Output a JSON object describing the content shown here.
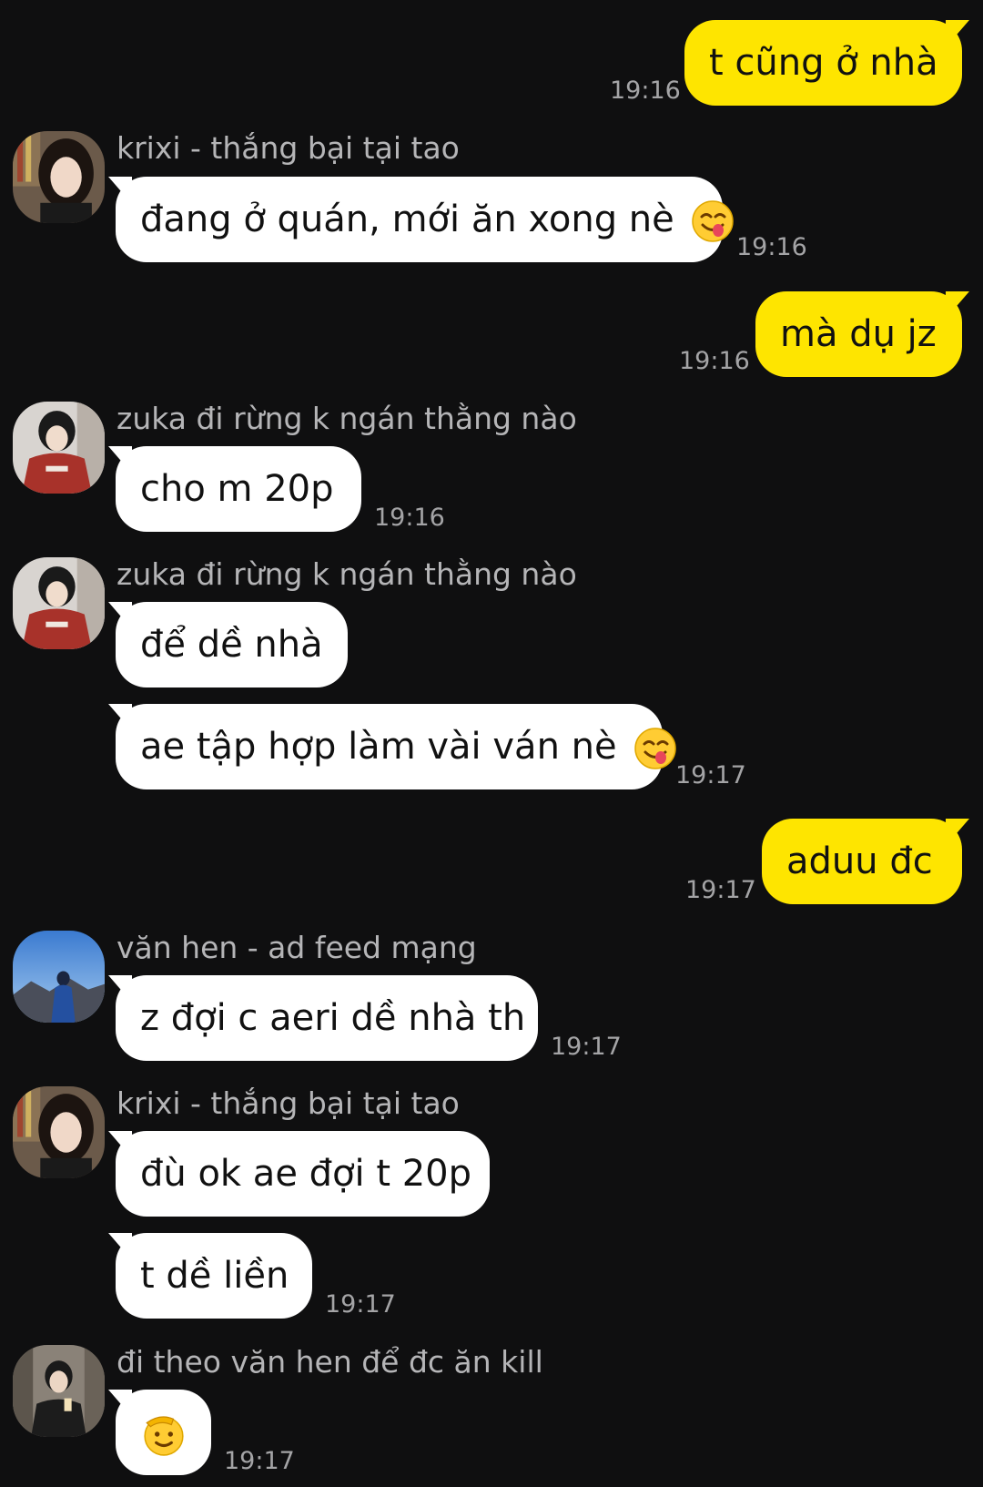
{
  "messages": [
    {
      "text": "t cũng ở nhà",
      "time": "19:16"
    },
    {
      "sender": "krixi - thắng bại tại tao",
      "text": "đang ở quán, mới ăn xong nè",
      "emoji": "yum-face-emoji",
      "time": "19:16"
    },
    {
      "text": "mà dụ jz",
      "time": "19:16"
    },
    {
      "sender": "zuka đi rừng k ngán thằng nào",
      "text": "cho m 20p",
      "time": "19:16"
    },
    {
      "sender": "zuka đi rừng k ngán thằng nào",
      "text": "để dề nhà"
    },
    {
      "text": "ae tập hợp làm vài ván nè",
      "emoji": "yum-face-emoji",
      "time": "19:17"
    },
    {
      "text": "aduu đc",
      "time": "19:17"
    },
    {
      "sender": "văn hen - ad feed mạng",
      "text": "z đợi c aeri dề nhà th",
      "time": "19:17"
    },
    {
      "sender": "krixi - thắng bại tại tao",
      "text": "đù ok ae đợi t 20p"
    },
    {
      "text": "t dề liền",
      "time": "19:17"
    },
    {
      "sender": "đi theo văn hen để đc ăn kill",
      "emoji": "salute-face-emoji",
      "time": "19:17"
    }
  ],
  "colors": {
    "background": "#0f0f10",
    "incoming_bubble": "#ffffff",
    "outgoing_bubble": "#fee500",
    "timestamp": "#a4a4a6",
    "sender_name": "#b5b5b7"
  }
}
